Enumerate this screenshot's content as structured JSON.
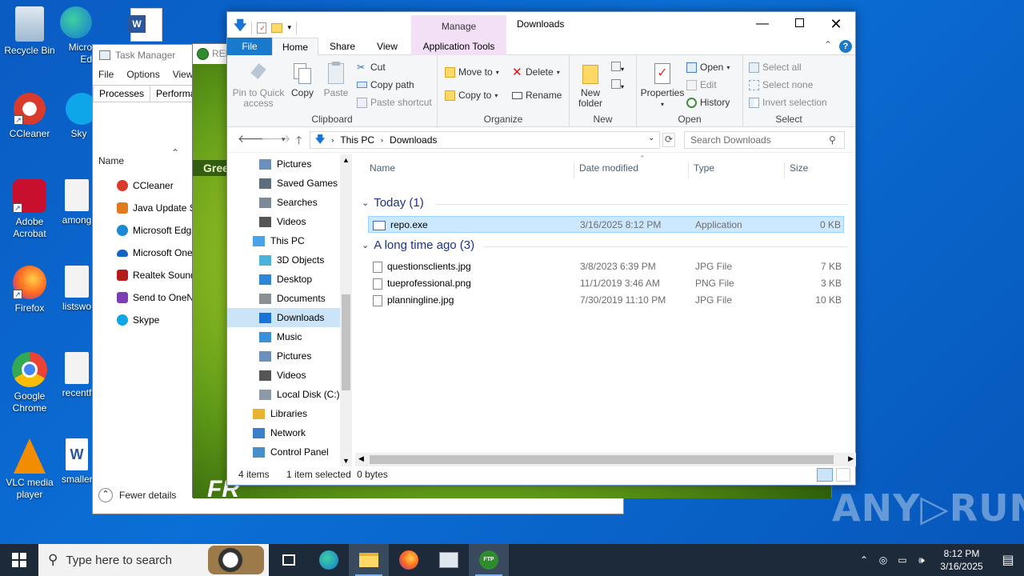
{
  "desktop": {
    "icons": [
      {
        "label": "Recycle Bin",
        "icon": "recycle-bin-icon"
      },
      {
        "label": "Micro Ed",
        "icon": "edge-icon"
      },
      {
        "label": "CCleaner",
        "icon": "ccleaner-icon"
      },
      {
        "label": "Sky",
        "icon": "skype-icon"
      },
      {
        "label": "Adobe Acrobat",
        "icon": "acrobat-icon"
      },
      {
        "label": "among",
        "icon": "image-file-icon"
      },
      {
        "label": "Firefox",
        "icon": "firefox-icon"
      },
      {
        "label": "listswo",
        "icon": "image-file-icon"
      },
      {
        "label": "Google Chrome",
        "icon": "chrome-icon"
      },
      {
        "label": "recentf",
        "icon": "image-file-icon"
      },
      {
        "label": "VLC media player",
        "icon": "vlc-icon"
      },
      {
        "label": "smaller",
        "icon": "word-icon"
      }
    ],
    "watermark": "ANY▷RUN"
  },
  "taskmanager": {
    "title": "Task Manager",
    "menu": [
      "File",
      "Options",
      "View"
    ],
    "tabs": [
      "Processes",
      "Performan"
    ],
    "col_name": "Name",
    "items": [
      {
        "label": "CCleaner",
        "color": "#d83b2b"
      },
      {
        "label": "Java Update Sc",
        "color": "#e07a1f"
      },
      {
        "label": "Microsoft Edg",
        "color": "#1a8ad4"
      },
      {
        "label": "Microsoft One",
        "color": "#1565c0"
      },
      {
        "label": "Realtek Sound",
        "color": "#b71c1c"
      },
      {
        "label": "Send to OneN",
        "color": "#7b3fb3"
      },
      {
        "label": "Skype",
        "color": "#0ea5e9"
      }
    ],
    "fewer_details": "Fewer details"
  },
  "ftp": {
    "title": "REF",
    "bar_text": "Gree",
    "big_text": "FR"
  },
  "explorer": {
    "title": "Downloads",
    "manage_label": "Manage",
    "tabs": {
      "file": "File",
      "home": "Home",
      "share": "Share",
      "view": "View",
      "app_tools": "Application Tools"
    },
    "ribbon": {
      "clipboard": {
        "label": "Clipboard",
        "pin": "Pin to Quick access",
        "copy": "Copy",
        "paste": "Paste",
        "cut": "Cut",
        "copy_path": "Copy path",
        "paste_shortcut": "Paste shortcut"
      },
      "organize": {
        "label": "Organize",
        "move_to": "Move to",
        "copy_to": "Copy to",
        "delete": "Delete",
        "rename": "Rename"
      },
      "new": {
        "label": "New",
        "new_folder": "New folder"
      },
      "open": {
        "label": "Open",
        "properties": "Properties",
        "open": "Open",
        "edit": "Edit",
        "history": "History"
      },
      "select": {
        "label": "Select",
        "select_all": "Select all",
        "select_none": "Select none",
        "invert": "Invert selection"
      }
    },
    "address": {
      "crumbs": [
        "This PC",
        "Downloads"
      ],
      "search_placeholder": "Search Downloads"
    },
    "nav": [
      {
        "label": "Pictures",
        "indent": 2,
        "icon": "pictures-icon"
      },
      {
        "label": "Saved Games",
        "indent": 2,
        "icon": "saved-games-icon"
      },
      {
        "label": "Searches",
        "indent": 2,
        "icon": "search-icon"
      },
      {
        "label": "Videos",
        "indent": 2,
        "icon": "videos-icon"
      },
      {
        "label": "This PC",
        "indent": 1,
        "icon": "computer-icon"
      },
      {
        "label": "3D Objects",
        "indent": 2,
        "icon": "3d-objects-icon"
      },
      {
        "label": "Desktop",
        "indent": 2,
        "icon": "desktop-icon"
      },
      {
        "label": "Documents",
        "indent": 2,
        "icon": "documents-icon"
      },
      {
        "label": "Downloads",
        "indent": 2,
        "icon": "downloads-icon",
        "selected": true
      },
      {
        "label": "Music",
        "indent": 2,
        "icon": "music-icon"
      },
      {
        "label": "Pictures",
        "indent": 2,
        "icon": "pictures-icon"
      },
      {
        "label": "Videos",
        "indent": 2,
        "icon": "videos-icon"
      },
      {
        "label": "Local Disk (C:)",
        "indent": 2,
        "icon": "drive-icon"
      },
      {
        "label": "Libraries",
        "indent": 1,
        "icon": "libraries-icon"
      },
      {
        "label": "Network",
        "indent": 1,
        "icon": "network-icon"
      },
      {
        "label": "Control Panel",
        "indent": 1,
        "icon": "control-panel-icon"
      }
    ],
    "columns": {
      "name": "Name",
      "date": "Date modified",
      "type": "Type",
      "size": "Size"
    },
    "groups": [
      {
        "title": "Today (1)",
        "files": [
          {
            "name": "repo.exe",
            "date": "3/16/2025 8:12 PM",
            "type": "Application",
            "size": "0 KB",
            "selected": true
          }
        ]
      },
      {
        "title": "A long time ago (3)",
        "files": [
          {
            "name": "questionsclients.jpg",
            "date": "3/8/2023 6:39 PM",
            "type": "JPG File",
            "size": "7 KB"
          },
          {
            "name": "tueprofessional.png",
            "date": "11/1/2019 3:46 AM",
            "type": "PNG File",
            "size": "3 KB"
          },
          {
            "name": "planningline.jpg",
            "date": "7/30/2019 11:10 PM",
            "type": "JPG File",
            "size": "10 KB"
          }
        ]
      }
    ],
    "status": {
      "items": "4 items",
      "selected": "1 item selected",
      "bytes": "0 bytes"
    }
  },
  "taskbar": {
    "search_placeholder": "Type here to search",
    "time": "8:12 PM",
    "date": "3/16/2025"
  }
}
